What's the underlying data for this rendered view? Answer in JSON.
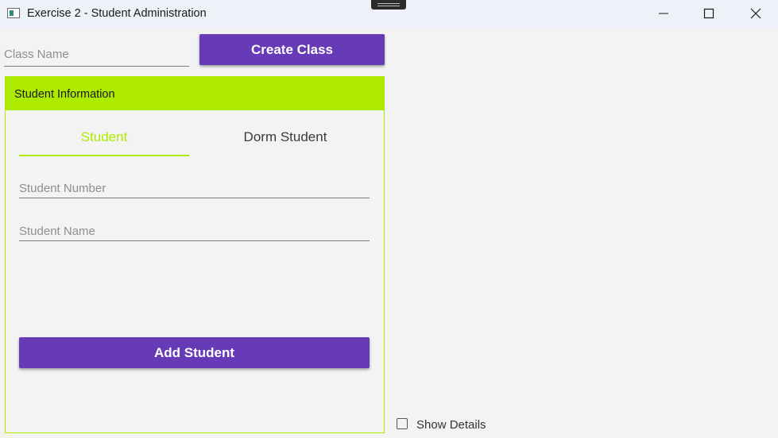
{
  "window": {
    "title": "Exercise 2 - Student Administration"
  },
  "class_form": {
    "class_name_placeholder": "Class Name",
    "class_name_value": "",
    "create_button_label": "Create Class"
  },
  "student_info": {
    "header": "Student Information",
    "tabs": [
      {
        "label": "Student",
        "selected": true
      },
      {
        "label": "Dorm Student",
        "selected": false
      }
    ],
    "student_number_placeholder": "Student Number",
    "student_number_value": "",
    "student_name_placeholder": "Student Name",
    "student_name_value": "",
    "add_button_label": "Add Student"
  },
  "options": {
    "show_details_label": "Show Details",
    "show_details_checked": false
  },
  "colors": {
    "accent_green": "#aeea00",
    "button_purple": "#673ab7",
    "background": "#f3f3f3",
    "titlebar": "#eef1f7"
  },
  "icons": {
    "app": "window-app-icon",
    "minimize": "minimize-icon",
    "maximize": "maximize-icon",
    "close": "close-icon"
  }
}
